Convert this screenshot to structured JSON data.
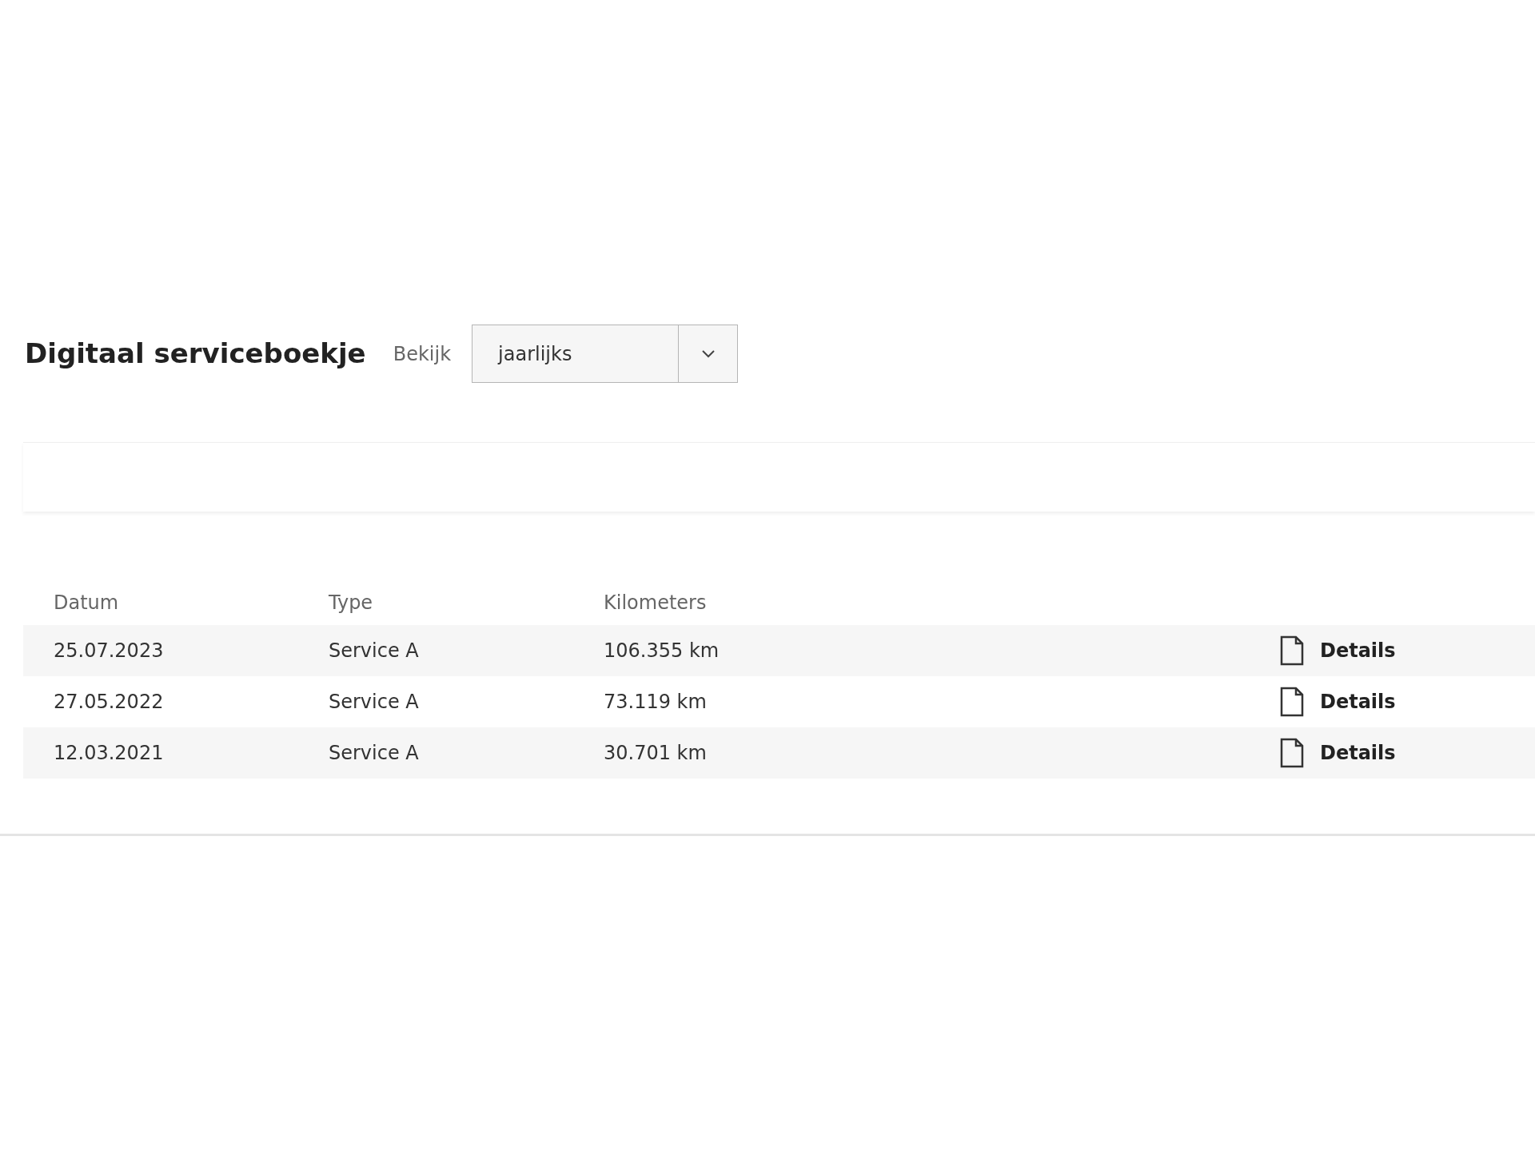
{
  "header": {
    "title": "Digitaal serviceboekje",
    "view_label": "Bekijk",
    "view_select": {
      "value": "jaarlijks"
    }
  },
  "table": {
    "columns": [
      "Datum",
      "Type",
      "Kilometers"
    ],
    "rows": [
      {
        "date": "25.07.2023",
        "type": "Service A",
        "km": "106.355 km",
        "action": "Details"
      },
      {
        "date": "27.05.2022",
        "type": "Service A",
        "km": "73.119 km",
        "action": "Details"
      },
      {
        "date": "12.03.2021",
        "type": "Service A",
        "km": "30.701 km",
        "action": "Details"
      }
    ]
  }
}
